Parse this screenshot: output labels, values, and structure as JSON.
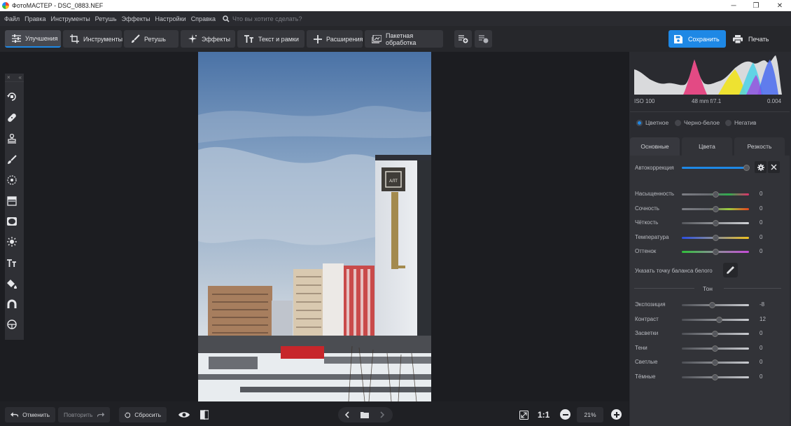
{
  "window": {
    "title": "ФотоМАСТЕР - DSC_0883.NEF"
  },
  "menu": {
    "items": [
      "Файл",
      "Правка",
      "Инструменты",
      "Ретушь",
      "Эффекты",
      "Настройки",
      "Справка"
    ],
    "search_placeholder": "Что вы хотите сделать?"
  },
  "toolbar": {
    "tabs": [
      {
        "label": "Улучшения",
        "icon": "sliders-icon"
      },
      {
        "label": "Инструменты",
        "icon": "crop-icon"
      },
      {
        "label": "Ретушь",
        "icon": "brush-icon"
      },
      {
        "label": "Эффекты",
        "icon": "sparkle-icon"
      },
      {
        "label": "Текст и рамки",
        "icon": "text-icon"
      },
      {
        "label": "Расширения",
        "icon": "plus-icon"
      }
    ],
    "batch_label": "Пакетная обработка",
    "save_label": "Сохранить",
    "print_label": "Печать",
    "active_tab": "Улучшения"
  },
  "left_tools": [
    "rotate-icon",
    "healing-icon",
    "stamp-icon",
    "brush-icon",
    "radial-icon",
    "gradient-icon",
    "vignette-icon",
    "light-icon",
    "text-icon",
    "fill-icon",
    "magnet-icon",
    "lens-icon"
  ],
  "histogram": {
    "iso": "ISO 100",
    "lens": "48 mm f/7.1",
    "shutter": "0.004"
  },
  "color_mode": {
    "options": [
      "Цветное",
      "Черно-белое",
      "Негатив"
    ],
    "selected": "Цветное"
  },
  "panel_tabs": [
    "Основные",
    "Цвета",
    "Резкость"
  ],
  "active_panel_tab": "Основные",
  "auto_correction": {
    "label": "Автокоррекция",
    "level": 0.97
  },
  "color_sliders": [
    {
      "label": "Насыщенность",
      "value": "0"
    },
    {
      "label": "Сочность",
      "value": "0"
    },
    {
      "label": "Чёткость",
      "value": "0"
    },
    {
      "label": "Температура",
      "value": "0"
    },
    {
      "label": "Оттенок",
      "value": "0"
    }
  ],
  "white_balance_label": "Указать точку баланса белого",
  "tone_header": "Тон",
  "tone_sliders": [
    {
      "label": "Экспозиция",
      "value": "-8",
      "num": -8
    },
    {
      "label": "Контраст",
      "value": "12",
      "num": 12
    },
    {
      "label": "Засветки",
      "value": "0",
      "num": 0
    },
    {
      "label": "Тени",
      "value": "0",
      "num": 0
    },
    {
      "label": "Светлые",
      "value": "0",
      "num": 0
    },
    {
      "label": "Тёмные",
      "value": "0",
      "num": 0
    }
  ],
  "bottom": {
    "undo_label": "Отменить",
    "redo_label": "Повторить",
    "reset_label": "Сбросить",
    "ratio_label": "1:1",
    "zoom": "21%"
  },
  "photo": {
    "sign_text": "АЛТ"
  }
}
